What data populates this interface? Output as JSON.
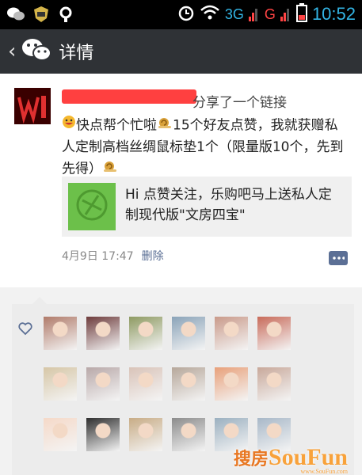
{
  "status_bar": {
    "network_3g": "3G",
    "network_g": "G",
    "time": "10:52",
    "icons": [
      "wechat-icon",
      "app-shield-icon",
      "signal-search-icon",
      "alarm-icon",
      "wifi-icon",
      "signal-bars-icon",
      "battery-icon"
    ]
  },
  "title_bar": {
    "back_symbol": "‹",
    "title": "详情"
  },
  "post": {
    "shared_text": "分享了一个链接",
    "content_part1": "快点帮个忙啦",
    "content_part2": "15个好友点赞，我就获赠私人定制高档丝绸鼠标垫1个（限量版10个，先到先得）",
    "link_text": "Hi 点赞关注，乐购吧马上送私人定制现代版\"文房四宝\"",
    "date": "4月9日 17:47",
    "delete_label": "删除"
  },
  "likes": {
    "count": 18,
    "avatar_colors": [
      "#b07b6a",
      "#6e3c3c",
      "#8e9a62",
      "#8aa3b8",
      "#c99a8a",
      "#c86b5a",
      "#d6c6a6",
      "#b8a8a8",
      "#d9c3b8",
      "#b6a79a",
      "#e8a07a",
      "#c8a89a",
      "#f5d9c8",
      "#2e2e2e",
      "#c8ac86",
      "#8c8c8c",
      "#9bb0c0",
      "#a8b8c8"
    ]
  },
  "watermark": {
    "brand_cn": "搜房",
    "brand_en": "SouFun",
    "domain": "www.SouFun.com"
  }
}
